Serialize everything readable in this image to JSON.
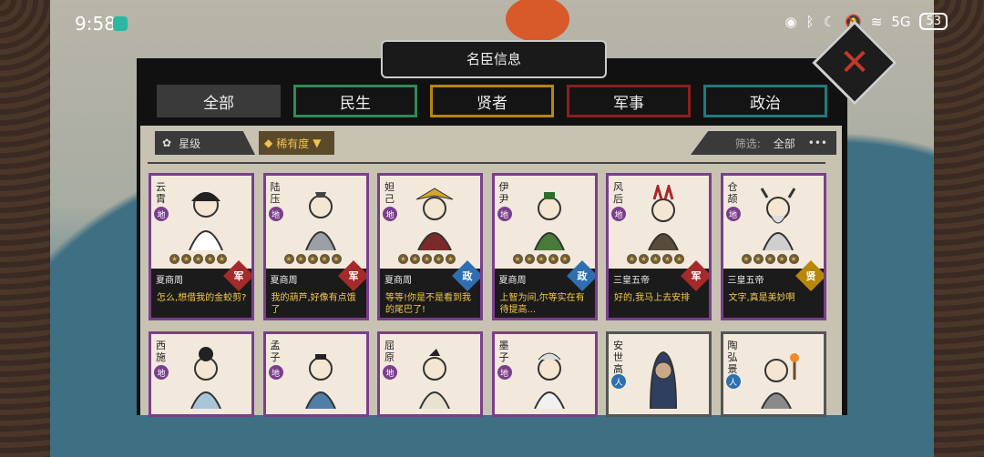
{
  "status": {
    "time": "9:58",
    "net": "5G",
    "battery": "53"
  },
  "panel": {
    "title": "名臣信息",
    "close_symbol": "✕"
  },
  "tabs": [
    {
      "label": "全部",
      "color": "#3a3a3a"
    },
    {
      "label": "民生",
      "color": "#2e8b57"
    },
    {
      "label": "贤者",
      "color": "#b8860b"
    },
    {
      "label": "军事",
      "color": "#8b1f1f"
    },
    {
      "label": "政治",
      "color": "#1f7b7b"
    }
  ],
  "filters": {
    "star": "星级",
    "rarity": "稀有度",
    "filter_label": "筛选:",
    "filter_value": "全部",
    "more": "•••"
  },
  "cards": [
    {
      "name": "云霄",
      "rank": "地",
      "era": "夏商周",
      "type": "军",
      "type_color": "#a52a2a",
      "quote": "怎么,想借我的金蛟剪?",
      "stars": 5
    },
    {
      "name": "陆压",
      "rank": "地",
      "era": "夏商周",
      "type": "军",
      "type_color": "#a52a2a",
      "quote": "我的葫芦,好像有点饿了",
      "stars": 5
    },
    {
      "name": "妲己",
      "rank": "地",
      "era": "夏商周",
      "type": "政",
      "type_color": "#2f6fb0",
      "quote": "等等!你是不是看到我的尾巴了!",
      "stars": 5
    },
    {
      "name": "伊尹",
      "rank": "地",
      "era": "夏商周",
      "type": "政",
      "type_color": "#2f6fb0",
      "quote": "上智为间,尔等实在有待提高...",
      "stars": 5
    },
    {
      "name": "风后",
      "rank": "地",
      "era": "三皇五帝",
      "type": "军",
      "type_color": "#a52a2a",
      "quote": "好的,我马上去安排",
      "stars": 5
    },
    {
      "name": "仓颉",
      "rank": "地",
      "era": "三皇五帝",
      "type": "贤",
      "type_color": "#b8860b",
      "quote": "文字,真是美妙啊",
      "stars": 5
    },
    {
      "name": "西施",
      "rank": "地"
    },
    {
      "name": "孟子",
      "rank": "地"
    },
    {
      "name": "屈原",
      "rank": "地"
    },
    {
      "name": "墨子",
      "rank": "地"
    },
    {
      "name": "安世高",
      "rank": "人"
    },
    {
      "name": "陶弘景",
      "rank": "人"
    }
  ]
}
